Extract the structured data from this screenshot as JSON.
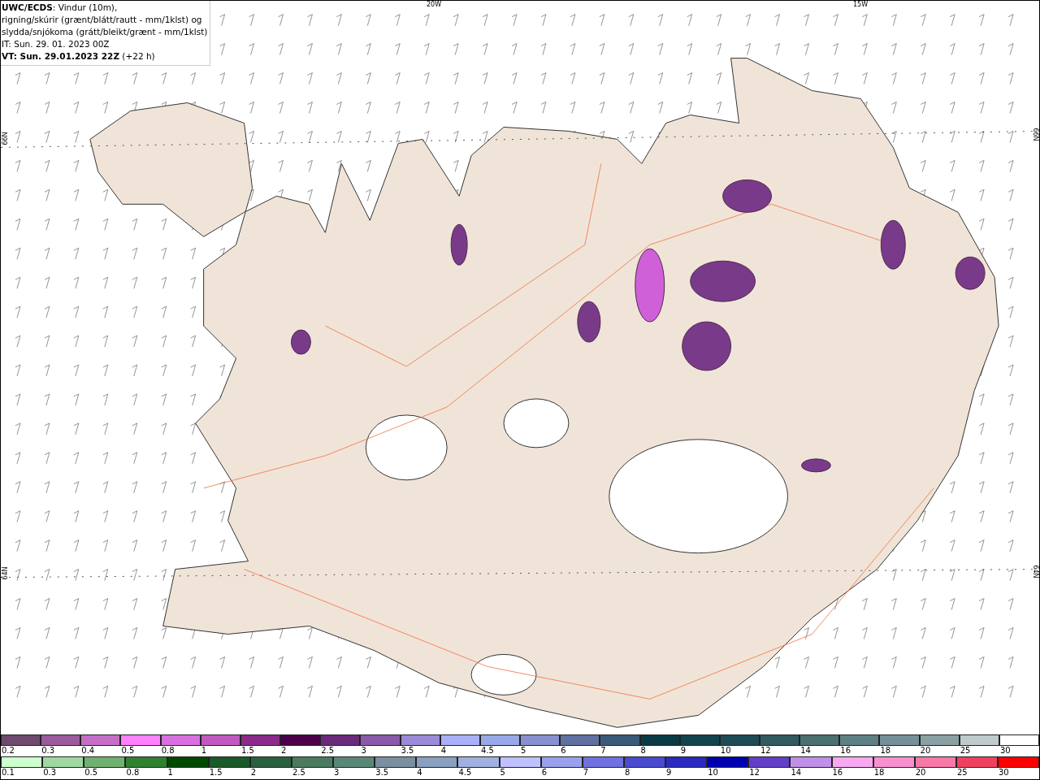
{
  "header": {
    "lines": [
      "**UWC/ECDS**: Vindur (10m),",
      "rigning/skúrir (grænt/blátt/rautt - mm/1klst) og",
      "slydda/snjókoma (grátt/bleikt/grænt - mm/1klst)",
      "IT: Sun. 29. 01. 2023 00Z",
      "**VT: Sun. 29.01.2023 22Z** (+22 h)"
    ]
  },
  "map": {
    "longitude_labels": [
      "20W",
      "15W"
    ],
    "latitude_labels_left": [
      "66N",
      "64N"
    ],
    "latitude_labels_right": [
      "66N",
      "64N"
    ]
  },
  "legend": [
    {
      "items": [
        {
          "label": "0.2",
          "color": "#6e4a6e"
        },
        {
          "label": "0.3",
          "color": "#9b5a9b"
        },
        {
          "label": "0.4",
          "color": "#c46ec8"
        },
        {
          "label": "0.5",
          "color": "#ff80ff"
        },
        {
          "label": "0.8",
          "color": "#d870e0"
        },
        {
          "label": "1",
          "color": "#c05ac0"
        },
        {
          "label": "1.5",
          "color": "#8a2a8a"
        },
        {
          "label": "2",
          "color": "#4a004a"
        },
        {
          "label": "2.5",
          "color": "#6a2a7a"
        },
        {
          "label": "3",
          "color": "#8a5aaa"
        },
        {
          "label": "3.5",
          "color": "#9a8ad8"
        },
        {
          "label": "4",
          "color": "#aab0f8"
        },
        {
          "label": "4.5",
          "color": "#98a8e8"
        },
        {
          "label": "5",
          "color": "#8890d0"
        },
        {
          "label": "6",
          "color": "#6070a0"
        },
        {
          "label": "7",
          "color": "#3a5a7a"
        },
        {
          "label": "8",
          "color": "#0a3a44"
        },
        {
          "label": "9",
          "color": "#12444e"
        },
        {
          "label": "10",
          "color": "#1e4a55"
        },
        {
          "label": "12",
          "color": "#305a60"
        },
        {
          "label": "14",
          "color": "#4a7070"
        },
        {
          "label": "16",
          "color": "#5e8084"
        },
        {
          "label": "18",
          "color": "#76909a"
        },
        {
          "label": "20",
          "color": "#8aa0a2"
        },
        {
          "label": "25",
          "color": "#c0cacc"
        },
        {
          "label": "30",
          "color": "#ffffff"
        }
      ]
    },
    {
      "items": [
        {
          "label": "0.1",
          "color": "#ccffcc"
        },
        {
          "label": "0.3",
          "color": "#a0d8a0"
        },
        {
          "label": "0.5",
          "color": "#70b070"
        },
        {
          "label": "0.8",
          "color": "#308030"
        },
        {
          "label": "1",
          "color": "#004a00"
        },
        {
          "label": "1.5",
          "color": "#1a5a2a"
        },
        {
          "label": "2",
          "color": "#2a6040"
        },
        {
          "label": "2.5",
          "color": "#4a7a60"
        },
        {
          "label": "3",
          "color": "#5a8878"
        },
        {
          "label": "3.5",
          "color": "#7890a0"
        },
        {
          "label": "4",
          "color": "#8aa0c0"
        },
        {
          "label": "4.5",
          "color": "#a0b0e0"
        },
        {
          "label": "5",
          "color": "#c0c0ff"
        },
        {
          "label": "6",
          "color": "#9aa0ee"
        },
        {
          "label": "7",
          "color": "#7070e0"
        },
        {
          "label": "8",
          "color": "#4a4ad0"
        },
        {
          "label": "9",
          "color": "#2a2ac0"
        },
        {
          "label": "10",
          "color": "#0000b0"
        },
        {
          "label": "12",
          "color": "#6040c8"
        },
        {
          "label": "14",
          "color": "#c090e8"
        },
        {
          "label": "16",
          "color": "#f8a8f0"
        },
        {
          "label": "18",
          "color": "#f890d0"
        },
        {
          "label": "20",
          "color": "#f878a8"
        },
        {
          "label": "25",
          "color": "#f04060"
        },
        {
          "label": "30",
          "color": "#ff0000"
        }
      ]
    }
  ]
}
